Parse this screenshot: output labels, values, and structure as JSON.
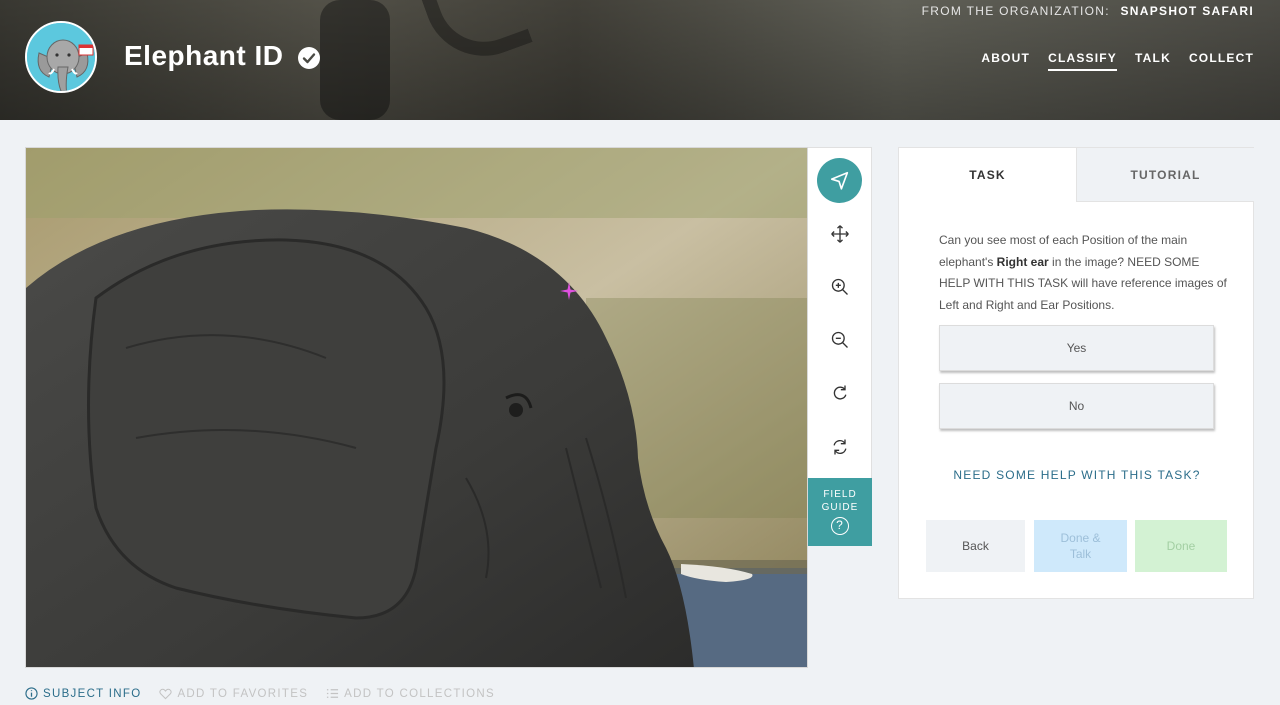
{
  "header": {
    "org_prefix": "FROM THE ORGANIZATION:",
    "org_name": "SNAPSHOT SAFARI",
    "project_title": "Elephant ID",
    "nav": [
      {
        "label": "ABOUT",
        "active": false
      },
      {
        "label": "CLASSIFY",
        "active": true
      },
      {
        "label": "TALK",
        "active": false
      },
      {
        "label": "COLLECT",
        "active": false
      }
    ]
  },
  "toolbar": {
    "tools": [
      "pointer-icon",
      "move-icon",
      "zoom-in-icon",
      "zoom-out-icon",
      "rotate-icon",
      "reset-icon"
    ],
    "field_guide_line1": "FIELD",
    "field_guide_line2": "GUIDE",
    "field_guide_symbol": "?"
  },
  "task_panel": {
    "tabs": [
      "TASK",
      "TUTORIAL"
    ],
    "question_part1": "Can you see most of each Position of the main elephant's ",
    "question_bold": "Right ear",
    "question_part2": " in the image? NEED SOME HELP WITH THIS TASK will have reference images of Left and Right and Ear Positions.",
    "answers": [
      "Yes",
      "No"
    ],
    "help_link": "NEED SOME HELP WITH THIS TASK?",
    "back_label": "Back",
    "done_talk_label": "Done & Talk",
    "done_label": "Done"
  },
  "meta": {
    "subject_info": "SUBJECT INFO",
    "add_favorites": "ADD TO FAVORITES",
    "add_collections": "ADD TO COLLECTIONS"
  },
  "colors": {
    "accent": "#3f9ea1",
    "link": "#2b6d8a",
    "done_talk_bg": "#cfe9fb",
    "done_bg": "#d3f2d3"
  }
}
